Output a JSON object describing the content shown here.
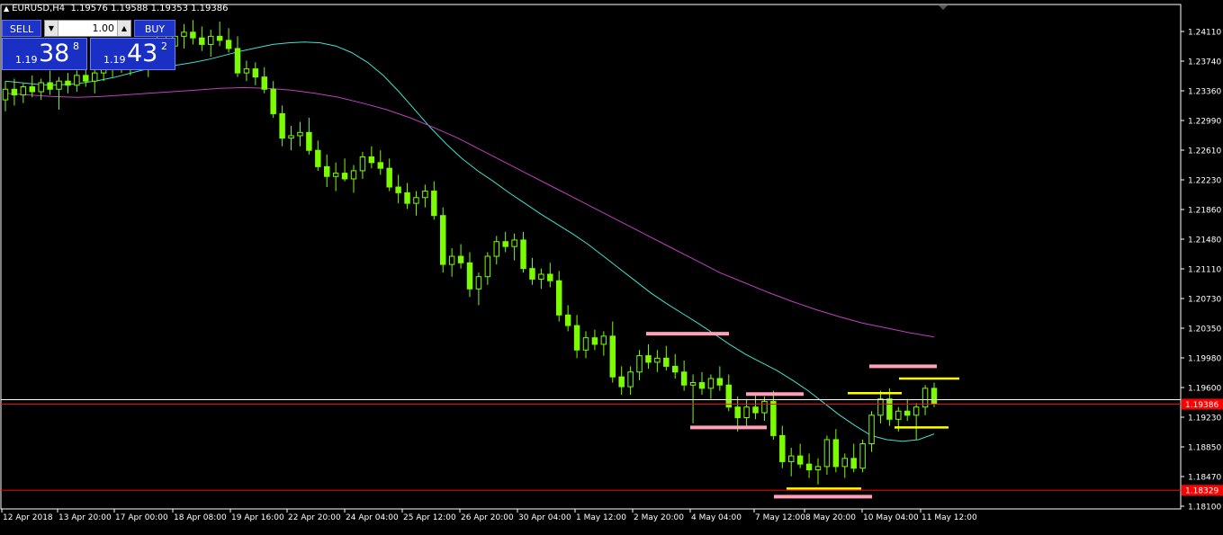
{
  "header": {
    "symbol_timeframe": "EURUSD,H4",
    "ohlc": "1.19576 1.19588 1.19353 1.19386"
  },
  "trade_panel": {
    "sell_label": "SELL",
    "buy_label": "BUY",
    "lot_value": "1.00",
    "sell_price": {
      "prefix": "1.19",
      "big": "38",
      "sup": "8"
    },
    "buy_price": {
      "prefix": "1.19",
      "big": "43",
      "sup": "2"
    }
  },
  "price_axis": {
    "labels": [
      "1.24110",
      "1.23740",
      "1.23360",
      "1.22990",
      "1.22610",
      "1.22230",
      "1.21860",
      "1.21480",
      "1.21110",
      "1.20730",
      "1.20350",
      "1.19980",
      "1.19600",
      "1.19230",
      "1.18850",
      "1.18470",
      "1.18100"
    ],
    "current_price_label": "1.19386",
    "low_line_label": "1.18329"
  },
  "time_axis": {
    "labels": [
      "12 Apr 2018",
      "13 Apr 20:00",
      "17 Apr 00:00",
      "18 Apr 08:00",
      "19 Apr 16:00",
      "22 Apr 20:00",
      "24 Apr 04:00",
      "25 Apr 12:00",
      "26 Apr 20:00",
      "30 Apr 04:00",
      "1 May 12:00",
      "2 May 20:00",
      "4 May 04:00",
      "7 May 12:00",
      "8 May 20:00",
      "10 May 04:00",
      "11 May 12:00"
    ]
  },
  "colors": {
    "background": "#000000",
    "candle": "#7CFC00",
    "ma_fast": "#40e0d0",
    "ma_slow": "#c040c0",
    "resistance_level": "#ff9fb8",
    "support_level": "#ffff00",
    "price_line_red": "#ff0000",
    "axis_text": "#ffffff",
    "button_blue": "#1e33c8"
  },
  "chart_data": {
    "type": "candlestick",
    "symbol": "EURUSD",
    "timeframe": "H4",
    "ylim": [
      1.181,
      1.2429
    ],
    "current_price": 1.19386,
    "horizontal_lines": [
      1.19386,
      1.18329
    ],
    "x_tick_labels": [
      "12 Apr 2018",
      "13 Apr 20:00",
      "17 Apr 00:00",
      "18 Apr 08:00",
      "19 Apr 16:00",
      "22 Apr 20:00",
      "24 Apr 04:00",
      "25 Apr 12:00",
      "26 Apr 20:00",
      "30 Apr 04:00",
      "1 May 12:00",
      "2 May 20:00",
      "4 May 04:00",
      "7 May 12:00",
      "8 May 20:00",
      "10 May 04:00",
      "11 May 12:00"
    ],
    "candles": [
      [
        1.2312,
        1.2335,
        1.2298,
        1.2325
      ],
      [
        1.2325,
        1.2338,
        1.2305,
        1.2318
      ],
      [
        1.2318,
        1.2332,
        1.2308,
        1.2328
      ],
      [
        1.2328,
        1.2342,
        1.2315,
        1.2322
      ],
      [
        1.2322,
        1.2338,
        1.2312,
        1.2333
      ],
      [
        1.2333,
        1.2348,
        1.2318,
        1.2325
      ],
      [
        1.2325,
        1.234,
        1.23,
        1.2335
      ],
      [
        1.2335,
        1.2345,
        1.232,
        1.233
      ],
      [
        1.233,
        1.2348,
        1.2322,
        1.2342
      ],
      [
        1.2342,
        1.2352,
        1.2328,
        1.2335
      ],
      [
        1.2335,
        1.235,
        1.232,
        1.2345
      ],
      [
        1.2345,
        1.2362,
        1.2335,
        1.235
      ],
      [
        1.235,
        1.2365,
        1.234,
        1.2358
      ],
      [
        1.2358,
        1.2375,
        1.2345,
        1.2352
      ],
      [
        1.2352,
        1.2368,
        1.2342,
        1.2362
      ],
      [
        1.2362,
        1.238,
        1.235,
        1.2358
      ],
      [
        1.2358,
        1.2372,
        1.234,
        1.2365
      ],
      [
        1.2365,
        1.239,
        1.2355,
        1.2385
      ],
      [
        1.2385,
        1.24,
        1.237,
        1.2378
      ],
      [
        1.2378,
        1.2395,
        1.2365,
        1.239
      ],
      [
        1.239,
        1.2405,
        1.2375,
        1.2395
      ],
      [
        1.2395,
        1.241,
        1.238,
        1.2388
      ],
      [
        1.2388,
        1.2402,
        1.2372,
        1.238
      ],
      [
        1.238,
        1.2398,
        1.2365,
        1.239
      ],
      [
        1.239,
        1.2408,
        1.2378,
        1.2385
      ],
      [
        1.2385,
        1.24,
        1.237,
        1.2375
      ],
      [
        1.2375,
        1.239,
        1.234,
        1.2345
      ],
      [
        1.2345,
        1.236,
        1.2335,
        1.235
      ],
      [
        1.235,
        1.2358,
        1.233,
        1.234
      ],
      [
        1.234,
        1.2352,
        1.232,
        1.2325
      ],
      [
        1.2325,
        1.2335,
        1.229,
        1.2295
      ],
      [
        1.2295,
        1.2305,
        1.2255,
        1.2265
      ],
      [
        1.2265,
        1.228,
        1.225,
        1.2268
      ],
      [
        1.2268,
        1.2285,
        1.2255,
        1.2272
      ],
      [
        1.2272,
        1.229,
        1.2245,
        1.225
      ],
      [
        1.225,
        1.2262,
        1.2225,
        1.223
      ],
      [
        1.223,
        1.2245,
        1.2205,
        1.2218
      ],
      [
        1.2218,
        1.2235,
        1.22,
        1.2222
      ],
      [
        1.2222,
        1.224,
        1.2212,
        1.2215
      ],
      [
        1.2215,
        1.2232,
        1.2198,
        1.2225
      ],
      [
        1.2225,
        1.2248,
        1.2215,
        1.2242
      ],
      [
        1.2242,
        1.2255,
        1.2228,
        1.2235
      ],
      [
        1.2235,
        1.225,
        1.222,
        1.2228
      ],
      [
        1.2228,
        1.224,
        1.22,
        1.2205
      ],
      [
        1.2205,
        1.222,
        1.2185,
        1.2198
      ],
      [
        1.2198,
        1.221,
        1.2178,
        1.2185
      ],
      [
        1.2185,
        1.22,
        1.217,
        1.2192
      ],
      [
        1.2192,
        1.2208,
        1.218,
        1.22
      ],
      [
        1.22,
        1.2212,
        1.2165,
        1.217
      ],
      [
        1.217,
        1.218,
        1.21,
        1.211
      ],
      [
        1.211,
        1.213,
        1.2095,
        1.212
      ],
      [
        1.212,
        1.2135,
        1.2105,
        1.2112
      ],
      [
        1.2112,
        1.2125,
        1.207,
        1.208
      ],
      [
        1.208,
        1.21,
        1.206,
        1.2095
      ],
      [
        1.2095,
        1.2125,
        1.2085,
        1.212
      ],
      [
        1.212,
        1.2145,
        1.211,
        1.2138
      ],
      [
        1.2138,
        1.215,
        1.2125,
        1.2132
      ],
      [
        1.2132,
        1.2148,
        1.2115,
        1.214
      ],
      [
        1.214,
        1.215,
        1.21,
        1.2105
      ],
      [
        1.2105,
        1.2118,
        1.2085,
        1.2092
      ],
      [
        1.2092,
        1.2105,
        1.208,
        1.2098
      ],
      [
        1.2098,
        1.2112,
        1.2082,
        1.209
      ],
      [
        1.209,
        1.2102,
        1.204,
        1.2048
      ],
      [
        1.2048,
        1.206,
        1.2028,
        1.2035
      ],
      [
        1.2035,
        1.2048,
        1.1995,
        1.2005
      ],
      [
        1.2005,
        1.2028,
        1.1995,
        1.202
      ],
      [
        1.202,
        1.203,
        1.2005,
        1.2012
      ],
      [
        1.2012,
        1.2028,
        1.1998,
        1.2022
      ],
      [
        1.2022,
        1.204,
        1.1965,
        1.1972
      ],
      [
        1.1972,
        1.1985,
        1.195,
        1.196
      ],
      [
        1.196,
        1.1985,
        1.195,
        1.1978
      ],
      [
        1.1978,
        1.2005,
        1.1968,
        1.1998
      ],
      [
        1.1998,
        1.2012,
        1.1982,
        1.199
      ],
      [
        1.199,
        1.2005,
        1.1978,
        1.1995
      ],
      [
        1.1995,
        1.201,
        1.198,
        1.1985
      ],
      [
        1.1985,
        1.2,
        1.197,
        1.1978
      ],
      [
        1.1978,
        1.1992,
        1.1955,
        1.1962
      ],
      [
        1.1962,
        1.1975,
        1.1915,
        1.1965
      ],
      [
        1.1965,
        1.1978,
        1.195,
        1.1958
      ],
      [
        1.1958,
        1.1975,
        1.1945,
        1.197
      ],
      [
        1.197,
        1.1985,
        1.1955,
        1.1962
      ],
      [
        1.1962,
        1.1975,
        1.193,
        1.1935
      ],
      [
        1.1935,
        1.1948,
        1.1905,
        1.1922
      ],
      [
        1.1922,
        1.1945,
        1.1912,
        1.1935
      ],
      [
        1.1935,
        1.195,
        1.192,
        1.1928
      ],
      [
        1.1928,
        1.1948,
        1.1918,
        1.1942
      ],
      [
        1.1942,
        1.1955,
        1.1895,
        1.19
      ],
      [
        1.19,
        1.1912,
        1.186,
        1.1868
      ],
      [
        1.1868,
        1.1885,
        1.185,
        1.1875
      ],
      [
        1.1875,
        1.189,
        1.186,
        1.1865
      ],
      [
        1.1865,
        1.1878,
        1.1848,
        1.1858
      ],
      [
        1.1858,
        1.1872,
        1.184,
        1.1862
      ],
      [
        1.1862,
        1.19,
        1.1852,
        1.1895
      ],
      [
        1.1895,
        1.1908,
        1.1855,
        1.1862
      ],
      [
        1.1862,
        1.1878,
        1.1848,
        1.1872
      ],
      [
        1.1872,
        1.189,
        1.1855,
        1.186
      ],
      [
        1.186,
        1.1895,
        1.1855,
        1.189
      ],
      [
        1.189,
        1.193,
        1.188,
        1.1925
      ],
      [
        1.1925,
        1.1955,
        1.1915,
        1.1945
      ],
      [
        1.1945,
        1.1958,
        1.1912,
        1.192
      ],
      [
        1.192,
        1.1935,
        1.1905,
        1.193
      ],
      [
        1.193,
        1.1945,
        1.1918,
        1.1925
      ],
      [
        1.1925,
        1.194,
        1.1895,
        1.1935
      ],
      [
        1.1935,
        1.1962,
        1.1925,
        1.1958
      ],
      [
        1.1958,
        1.1965,
        1.1935,
        1.1939
      ]
    ],
    "series": [
      {
        "values": [
          1.2335,
          1.2333,
          1.2331,
          1.233,
          1.2331,
          1.2333,
          1.2336,
          1.234,
          1.2345,
          1.235,
          1.2353,
          1.2355,
          1.2358,
          1.2362,
          1.2367,
          1.2372,
          1.2376,
          1.238,
          1.2382,
          1.2383,
          1.2382,
          1.2378,
          1.237,
          1.2358,
          1.2342,
          1.2322,
          1.23,
          1.2278,
          1.2258,
          1.224,
          1.2225,
          1.2212,
          1.2198,
          1.2185,
          1.2172,
          1.216,
          1.2148,
          1.2135,
          1.212,
          1.2105,
          1.209,
          1.2075,
          1.2062,
          1.205,
          1.2038,
          1.2025,
          1.2012,
          1.2,
          1.199,
          1.198,
          1.1968,
          1.1955,
          1.194,
          1.1925,
          1.1912,
          1.19,
          1.1895,
          1.1893,
          1.1895,
          1.1902
        ]
      },
      {
        "values": [
          1.232,
          1.2318,
          1.2316,
          1.2315,
          1.2316,
          1.2318,
          1.232,
          1.2322,
          1.2324,
          1.2326,
          1.2327,
          1.2326,
          1.2324,
          1.232,
          1.2315,
          1.2308,
          1.23,
          1.229,
          1.2278,
          1.2265,
          1.225,
          1.2235,
          1.222,
          1.2205,
          1.219,
          1.2175,
          1.216,
          1.2145,
          1.213,
          1.2115,
          1.21,
          1.2088,
          1.2076,
          1.2065,
          1.2055,
          1.2046,
          1.2038,
          1.2032,
          1.2026,
          1.2021
        ]
      }
    ],
    "levels_resistance": [
      1.2025,
      1.1951,
      1.191,
      1.1985,
      1.1825
    ],
    "levels_support": [
      1.1835,
      1.1952,
      1.197,
      1.191
    ]
  }
}
